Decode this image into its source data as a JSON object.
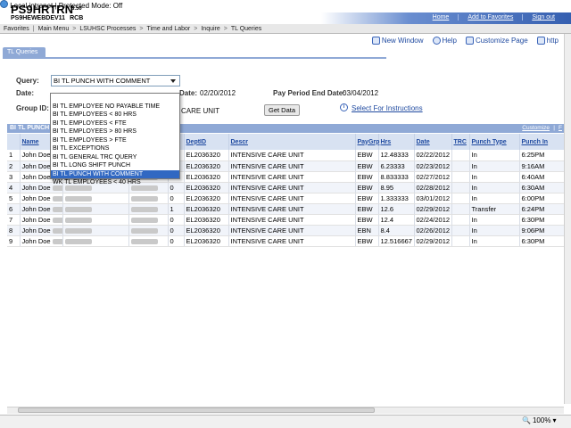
{
  "header": {
    "title": "PS9HRTRN",
    "version": "8.50",
    "database": "PS9HEWEBDEV11",
    "user": "RCB",
    "links": [
      "Home",
      "Add to Favorites",
      "Sign out"
    ]
  },
  "breadcrumb": [
    "Favorites",
    "Main Menu",
    "LSUHSC Processes",
    "Time and Labor",
    "Inquire",
    "TL Queries"
  ],
  "tools": [
    "New Window",
    "Help",
    "Customize Page",
    "http"
  ],
  "tab": "TL Queries",
  "form": {
    "query_label": "Query:",
    "query_value": "BI TL PUNCH WITH COMMENT",
    "date_label": "Date:",
    "date_label2": "Date:",
    "date_value": "02/20/2012",
    "period_end_label": "Pay Period End Date:",
    "period_end_value": "03/04/2012",
    "group_label": "Group ID:",
    "group_value": "CARE UNIT",
    "get_data": "Get Data",
    "instructions": "Select For Instructions"
  },
  "dropdown_options": [
    "",
    "BI TL EMPLOYEE NO PAYABLE TIME",
    "BI TL EMPLOYEES < 80 HRS",
    "BI TL EMPLOYEES < FTE",
    "BI TL EMPLOYEES > 80 HRS",
    "BI TL EMPLOYEES > FTE",
    "BI TL EXCEPTIONS",
    "BI TL GENERAL TRC QUERY",
    "BI TL LONG SHIFT PUNCH",
    "BI TL PUNCH WITH COMMENT",
    "WK TL EMPLOYEES < 40 HRS"
  ],
  "grid": {
    "title": "BI TL PUNCH",
    "customize": "Customize",
    "find": "F",
    "columns": [
      "",
      "Name",
      "",
      "",
      "#",
      "DeptID",
      "Descr",
      "PayGrp",
      "Hrs",
      "Date",
      "TRC",
      "Punch Type",
      "Punch In"
    ],
    "rows": [
      {
        "n": "1",
        "name": "John Doe",
        "c": "0",
        "dept": "EL2036320",
        "descr": "INTENSIVE CARE UNIT",
        "pay": "EBW",
        "hrs": "12.48333",
        "date": "02/22/2012",
        "trc": "",
        "type": "In",
        "punch": "6:25PM"
      },
      {
        "n": "2",
        "name": "John Doe",
        "c": "0",
        "dept": "EL2036320",
        "descr": "INTENSIVE CARE UNIT",
        "pay": "EBW",
        "hrs": "6.23333",
        "date": "02/23/2012",
        "trc": "",
        "type": "In",
        "punch": "9:16AM"
      },
      {
        "n": "3",
        "name": "John Doe",
        "c": "0",
        "dept": "EL2036320",
        "descr": "INTENSIVE CARE UNIT",
        "pay": "EBW",
        "hrs": "8.833333",
        "date": "02/27/2012",
        "trc": "",
        "type": "In",
        "punch": "6:40AM"
      },
      {
        "n": "4",
        "name": "John Doe",
        "c": "0",
        "dept": "EL2036320",
        "descr": "INTENSIVE CARE UNIT",
        "pay": "EBW",
        "hrs": "8.95",
        "date": "02/28/2012",
        "trc": "",
        "type": "In",
        "punch": "6:30AM"
      },
      {
        "n": "5",
        "name": "John Doe",
        "c": "0",
        "dept": "EL2036320",
        "descr": "INTENSIVE CARE UNIT",
        "pay": "EBW",
        "hrs": "1.333333",
        "date": "03/01/2012",
        "trc": "",
        "type": "In",
        "punch": "6:00PM"
      },
      {
        "n": "6",
        "name": "John Doe",
        "c": "1",
        "dept": "EL2036320",
        "descr": "INTENSIVE CARE UNIT",
        "pay": "EBW",
        "hrs": "12.6",
        "date": "02/29/2012",
        "trc": "",
        "type": "Transfer",
        "punch": "6:24PM"
      },
      {
        "n": "7",
        "name": "John Doe",
        "c": "0",
        "dept": "EL2036320",
        "descr": "INTENSIVE CARE UNIT",
        "pay": "EBW",
        "hrs": "12.4",
        "date": "02/24/2012",
        "trc": "",
        "type": "In",
        "punch": "6:30PM"
      },
      {
        "n": "8",
        "name": "John Doe",
        "c": "0",
        "dept": "EL2036320",
        "descr": "INTENSIVE CARE UNIT",
        "pay": "EBN",
        "hrs": "8.4",
        "date": "02/26/2012",
        "trc": "",
        "type": "In",
        "punch": "9:06PM"
      },
      {
        "n": "9",
        "name": "John Doe",
        "c": "0",
        "dept": "EL2036320",
        "descr": "INTENSIVE CARE UNIT",
        "pay": "EBW",
        "hrs": "12.516667",
        "date": "02/29/2012",
        "trc": "",
        "type": "In",
        "punch": "6:30PM"
      }
    ]
  },
  "status": {
    "zone": "Local intranet | Protected Mode: Off",
    "zoom": "100%"
  },
  "colors": {
    "header_blue": "#355fb0",
    "tab_blue": "#8fa9d6",
    "link_blue": "#1f4aa0",
    "selected_option": "#3168c2"
  }
}
